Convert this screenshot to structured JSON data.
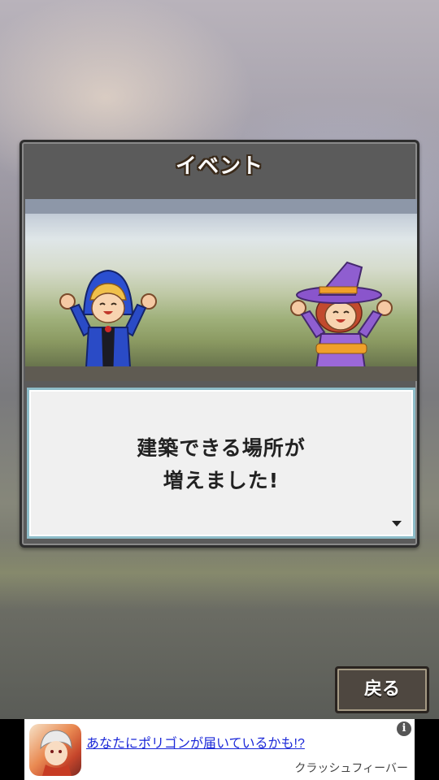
{
  "dialog": {
    "title": "イベント",
    "message_line1": "建築できる場所が",
    "message_line2": "増えました!"
  },
  "buttons": {
    "back_label": "戻る"
  },
  "ad": {
    "title": "あなたにポリゴンが届いているかも!?",
    "advertiser": "クラッシュフィーバー",
    "info_symbol": "i"
  },
  "icons": {
    "next-arrow": "down-triangle",
    "info": "info-circle"
  }
}
